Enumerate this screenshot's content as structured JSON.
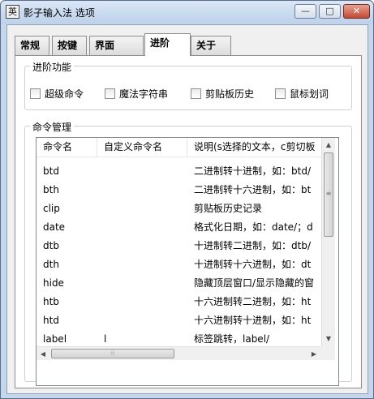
{
  "window": {
    "title": "影子输入法 选项",
    "icon_glyph": "英",
    "controls": {
      "minimize": "—",
      "maximize": "□",
      "close": "✕"
    }
  },
  "tabs": [
    {
      "label": "常规",
      "active": false
    },
    {
      "label": "按键",
      "active": false
    },
    {
      "label": "界面",
      "active": false
    },
    {
      "label": "进阶",
      "active": true
    },
    {
      "label": "关于",
      "active": false
    }
  ],
  "advanced": {
    "group_label": "进阶功能",
    "checkboxes": [
      {
        "label": "超级命令",
        "checked": false
      },
      {
        "label": "魔法字符串",
        "checked": false
      },
      {
        "label": "剪贴板历史",
        "checked": false
      },
      {
        "label": "鼠标划词",
        "checked": false
      }
    ]
  },
  "commands": {
    "group_label": "命令管理",
    "columns": [
      "命令名",
      "自定义命令名",
      "说明(s选择的文本，c剪切板"
    ],
    "rows": [
      {
        "name": "btd",
        "custom": "",
        "desc": "二进制转十进制，如：btd/"
      },
      {
        "name": "bth",
        "custom": "",
        "desc": "二进制转十六进制，如：bt"
      },
      {
        "name": "clip",
        "custom": "",
        "desc": "剪贴板历史记录"
      },
      {
        "name": "date",
        "custom": "",
        "desc": "格式化日期，如：date/；d"
      },
      {
        "name": "dtb",
        "custom": "",
        "desc": "十进制转二进制，如：dtb/"
      },
      {
        "name": "dth",
        "custom": "",
        "desc": "十进制转十六进制，如：dt"
      },
      {
        "name": "hide",
        "custom": "",
        "desc": "隐藏顶层窗口/显示隐藏的窗"
      },
      {
        "name": "htb",
        "custom": "",
        "desc": "十六进制转二进制，如：ht"
      },
      {
        "name": "htd",
        "custom": "",
        "desc": "十六进制转十进制，如：ht"
      },
      {
        "name": "label",
        "custom": "l",
        "desc": "标签跳转，label/"
      }
    ],
    "scrollbar": {
      "up": "▲",
      "down": "▼",
      "left": "◀",
      "right": "▶",
      "grip_v": "≡",
      "grip_h": "⦙⦙⦙"
    }
  }
}
